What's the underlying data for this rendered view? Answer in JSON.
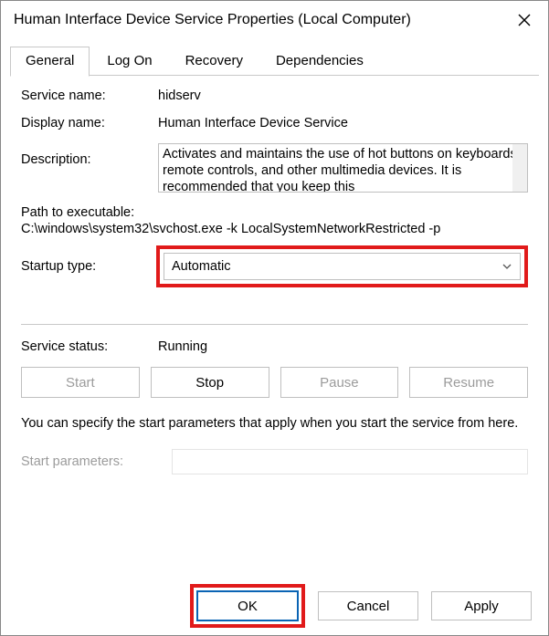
{
  "window": {
    "title": "Human Interface Device Service Properties (Local Computer)"
  },
  "tabs": {
    "general": "General",
    "logon": "Log On",
    "recovery": "Recovery",
    "dependencies": "Dependencies"
  },
  "fields": {
    "service_name_label": "Service name:",
    "service_name_value": "hidserv",
    "display_name_label": "Display name:",
    "display_name_value": "Human Interface Device Service",
    "description_label": "Description:",
    "description_value": "Activates and maintains the use of hot buttons on keyboards, remote controls, and other multimedia devices. It is recommended that you keep this",
    "path_label": "Path to executable:",
    "path_value": "C:\\windows\\system32\\svchost.exe -k LocalSystemNetworkRestricted -p",
    "startup_type_label": "Startup type:",
    "startup_type_value": "Automatic",
    "service_status_label": "Service status:",
    "service_status_value": "Running",
    "hint": "You can specify the start parameters that apply when you start the service from here.",
    "start_params_label": "Start parameters:",
    "start_params_value": ""
  },
  "buttons": {
    "start": "Start",
    "stop": "Stop",
    "pause": "Pause",
    "resume": "Resume",
    "ok": "OK",
    "cancel": "Cancel",
    "apply": "Apply"
  }
}
